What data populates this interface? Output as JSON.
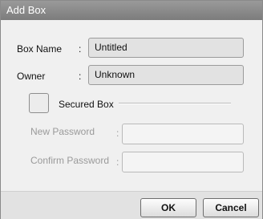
{
  "window": {
    "title": "Add Box"
  },
  "form": {
    "box_name": {
      "label": "Box Name",
      "colon": ":",
      "value": "Untitled"
    },
    "owner": {
      "label": "Owner",
      "colon": ":",
      "value": "Unknown"
    },
    "secured": {
      "label": "Secured Box",
      "checked": false
    },
    "new_password": {
      "label": "New Password",
      "colon": ":",
      "value": ""
    },
    "confirm_password": {
      "label": "Confirm Password",
      "colon": ":",
      "value": ""
    }
  },
  "buttons": {
    "ok": "OK",
    "cancel": "Cancel"
  }
}
